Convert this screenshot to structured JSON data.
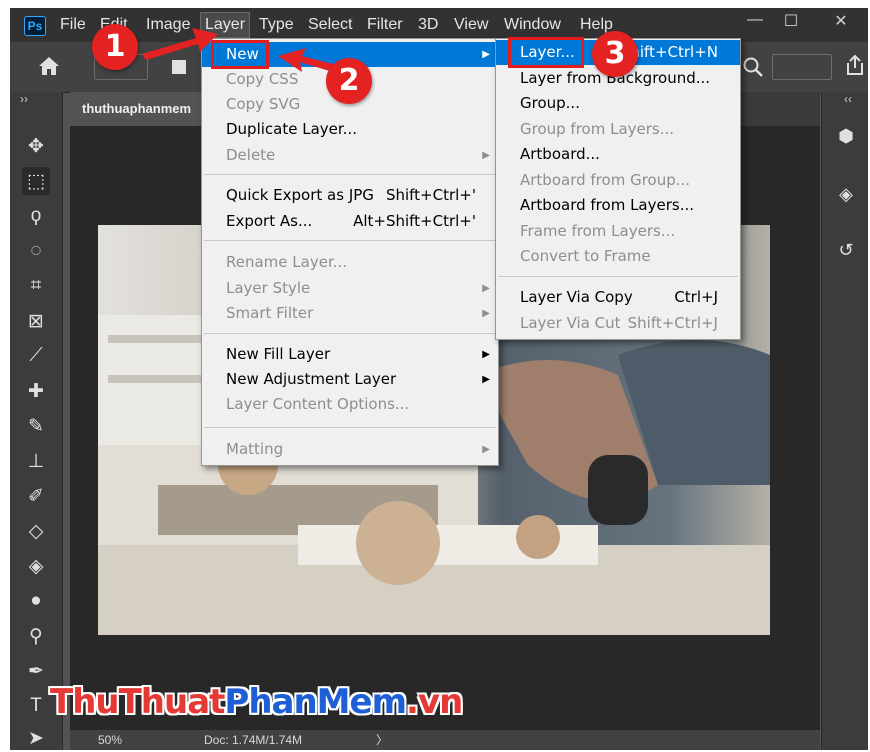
{
  "menubar": {
    "app_icon": "Ps",
    "items": [
      "File",
      "Edit",
      "Image",
      "Layer",
      "Type",
      "Select",
      "Filter",
      "3D",
      "View",
      "Window",
      "Help"
    ],
    "active_item": "Layer",
    "window_controls": [
      "—",
      "☐",
      "✕"
    ]
  },
  "document": {
    "tab_title": "thuthuaphanmem",
    "zoom": "50%",
    "doc_info": "Doc: 1.74M/1.74M",
    "status_arrow": "〉"
  },
  "toolbar": {
    "collapse": "››",
    "tools": [
      "move-tool",
      "marquee-tool",
      "lasso-tool",
      "quick-select-tool",
      "crop-tool",
      "frame-tool",
      "eyedropper-tool",
      "healing-tool",
      "brush-tool",
      "stamp-tool",
      "history-brush-tool",
      "eraser-tool",
      "paint-bucket-tool",
      "blur-tool",
      "dodge-tool",
      "pen-tool",
      "type-tool",
      "path-select-tool"
    ]
  },
  "right_panel": {
    "collapse": "‹‹",
    "icons": [
      "3d-panel-icon",
      "layers-panel-icon",
      "history-panel-icon"
    ]
  },
  "layer_menu": {
    "items": [
      {
        "label": "New",
        "shortcut": "",
        "submenu": true,
        "disabled": false,
        "highlighted": true
      },
      {
        "label": "Copy CSS",
        "shortcut": "",
        "submenu": false,
        "disabled": true
      },
      {
        "label": "Copy SVG",
        "shortcut": "",
        "submenu": false,
        "disabled": true
      },
      {
        "label": "Duplicate Layer...",
        "shortcut": "",
        "submenu": false,
        "disabled": false
      },
      {
        "label": "Delete",
        "shortcut": "",
        "submenu": true,
        "disabled": true
      },
      {
        "label": "Quick Export as JPG",
        "shortcut": "Shift+Ctrl+'",
        "submenu": false,
        "disabled": false
      },
      {
        "label": "Export As...",
        "shortcut": "Alt+Shift+Ctrl+'",
        "submenu": false,
        "disabled": false
      },
      {
        "label": "Rename Layer...",
        "shortcut": "",
        "submenu": false,
        "disabled": true
      },
      {
        "label": "Layer Style",
        "shortcut": "",
        "submenu": true,
        "disabled": true
      },
      {
        "label": "Smart Filter",
        "shortcut": "",
        "submenu": true,
        "disabled": true
      },
      {
        "label": "New Fill Layer",
        "shortcut": "",
        "submenu": true,
        "disabled": false
      },
      {
        "label": "New Adjustment Layer",
        "shortcut": "",
        "submenu": true,
        "disabled": false
      },
      {
        "label": "Layer Content Options...",
        "shortcut": "",
        "submenu": false,
        "disabled": true
      },
      {
        "label": "Matting",
        "shortcut": "",
        "submenu": true,
        "disabled": true
      }
    ]
  },
  "new_submenu": {
    "items": [
      {
        "label": "Layer...",
        "shortcut": "Shift+Ctrl+N",
        "disabled": false,
        "highlighted": true
      },
      {
        "label": "Layer from Background...",
        "shortcut": "",
        "disabled": false
      },
      {
        "label": "Group...",
        "shortcut": "",
        "disabled": false
      },
      {
        "label": "Group from Layers...",
        "shortcut": "",
        "disabled": true
      },
      {
        "label": "Artboard...",
        "shortcut": "",
        "disabled": false
      },
      {
        "label": "Artboard from Group...",
        "shortcut": "",
        "disabled": true
      },
      {
        "label": "Artboard from Layers...",
        "shortcut": "",
        "disabled": false
      },
      {
        "label": "Frame from Layers...",
        "shortcut": "",
        "disabled": true
      },
      {
        "label": "Convert to Frame",
        "shortcut": "",
        "disabled": true
      },
      {
        "label": "Layer Via Copy",
        "shortcut": "Ctrl+J",
        "disabled": false
      },
      {
        "label": "Layer Via Cut",
        "shortcut": "Shift+Ctrl+J",
        "disabled": true
      }
    ]
  },
  "annotations": {
    "steps": [
      "1",
      "2",
      "3"
    ],
    "color": "#e31d1d"
  },
  "watermark": {
    "part1": "ThuThuat",
    "part2": "PhanMem",
    "part3": ".vn"
  },
  "colors": {
    "menu_highlight": "#0078d7",
    "accent_red": "#e52222",
    "ps_blue": "#31a8ff"
  }
}
